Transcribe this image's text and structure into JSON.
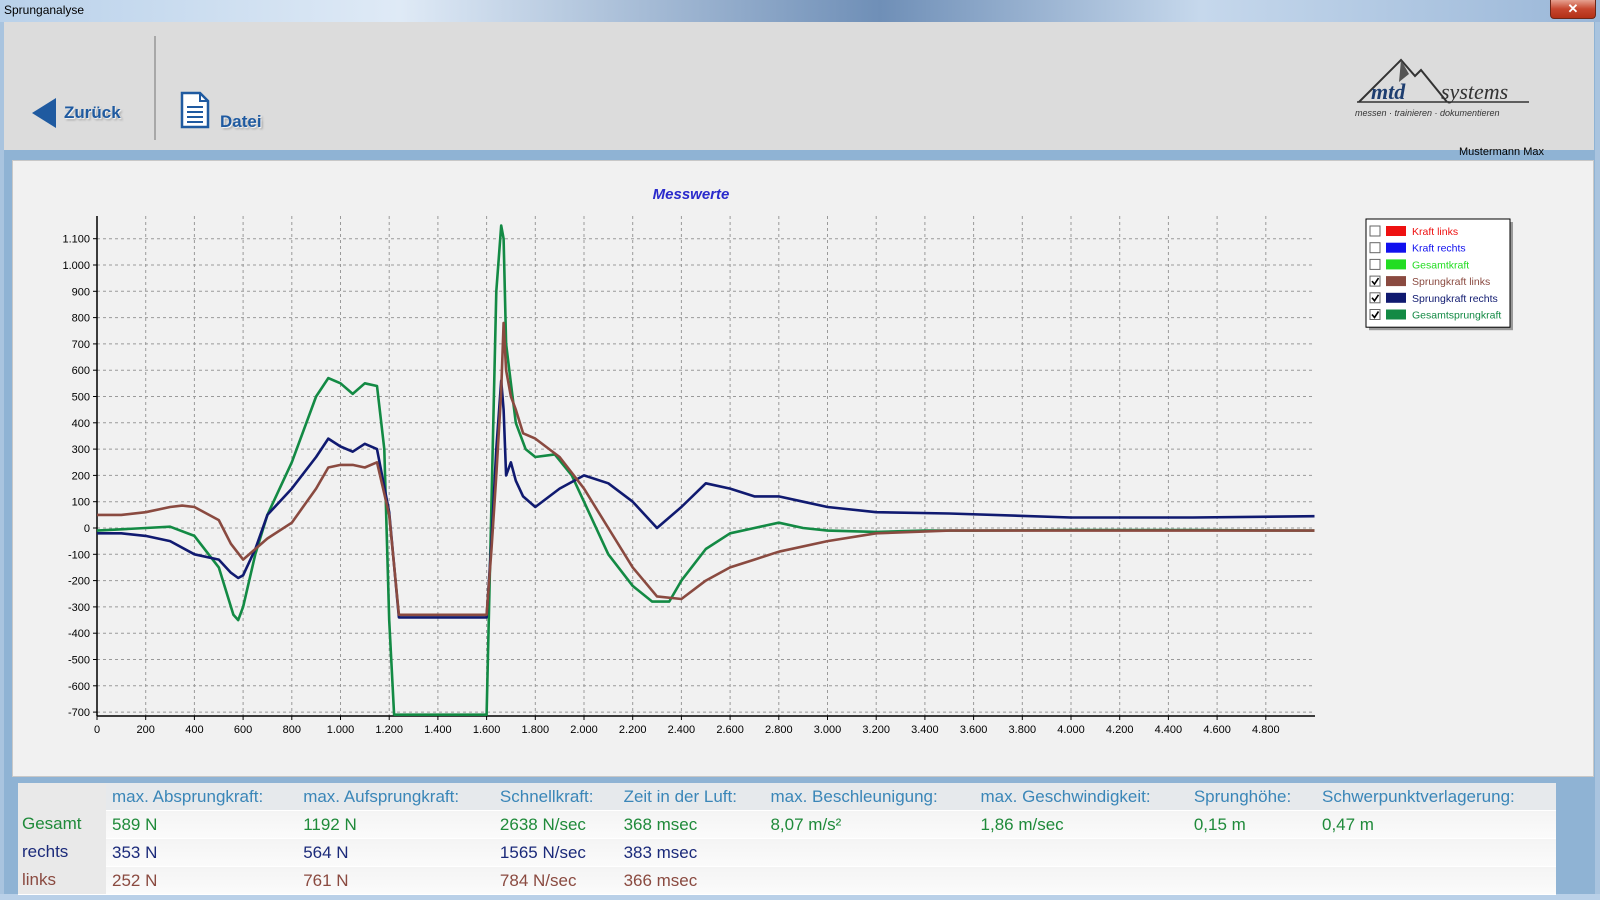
{
  "window": {
    "title": "Sprunganalyse",
    "close_glyph": "✕"
  },
  "toolbar": {
    "back_label": "Zurück",
    "file_label": "Datei"
  },
  "logo": {
    "brand1": "mtd",
    "brand2": "systems",
    "tagline": "messen · trainieren · dokumentieren"
  },
  "user": {
    "name": "Mustermann Max"
  },
  "chart_data": {
    "type": "line",
    "title": "Messwerte",
    "xlim": [
      0,
      5000
    ],
    "ylim": [
      -730,
      1200
    ],
    "x_ticks": [
      0,
      200,
      400,
      600,
      800,
      1000,
      1200,
      1400,
      1600,
      1800,
      2000,
      2200,
      2400,
      2600,
      2800,
      3000,
      3200,
      3400,
      3600,
      3800,
      4000,
      4200,
      4400,
      4600,
      4800
    ],
    "x_tick_labels": [
      "0",
      "200",
      "400",
      "600",
      "800",
      "1.000",
      "1.200",
      "1.400",
      "1.600",
      "1.800",
      "2.000",
      "2.200",
      "2.400",
      "2.600",
      "2.800",
      "3.000",
      "3.200",
      "3.400",
      "3.600",
      "3.800",
      "4.000",
      "4.200",
      "4.400",
      "4.600",
      "4.800"
    ],
    "y_ticks": [
      1100,
      1000,
      900,
      800,
      700,
      600,
      500,
      400,
      300,
      200,
      100,
      0,
      -100,
      -200,
      -300,
      -400,
      -500,
      -600,
      -700
    ],
    "y_tick_labels": [
      "1.100",
      "1.000",
      "900",
      "800",
      "700",
      "600",
      "500",
      "400",
      "300",
      "200",
      "100",
      "0",
      "-100",
      "-200",
      "-300",
      "-400",
      "-500",
      "-600",
      "-700"
    ],
    "grid": true,
    "legend_position": "top-right",
    "legend": [
      {
        "name": "Kraft links",
        "color": "#ee1111",
        "checked": false
      },
      {
        "name": "Kraft rechts",
        "color": "#1111ee",
        "checked": false
      },
      {
        "name": "Gesamtkraft",
        "color": "#22dd22",
        "checked": false
      },
      {
        "name": "Sprungkraft links",
        "color": "#8a4a40",
        "checked": true
      },
      {
        "name": "Sprungkraft rechts",
        "color": "#101a70",
        "checked": true
      },
      {
        "name": "Gesamtsprungkraft",
        "color": "#138a44",
        "checked": true
      }
    ],
    "series": [
      {
        "name": "Gesamtsprungkraft",
        "color": "#138a44",
        "x": [
          0,
          100,
          200,
          300,
          400,
          500,
          560,
          580,
          600,
          650,
          700,
          800,
          900,
          950,
          1000,
          1050,
          1100,
          1150,
          1180,
          1200,
          1220,
          1600,
          1620,
          1640,
          1660,
          1670,
          1680,
          1700,
          1720,
          1760,
          1800,
          1880,
          1950,
          2000,
          2100,
          2200,
          2280,
          2350,
          2400,
          2500,
          2600,
          2700,
          2800,
          2900,
          3000,
          3200,
          3400,
          3600,
          4000,
          4500,
          5000
        ],
        "y": [
          -10,
          -5,
          0,
          5,
          -30,
          -150,
          -330,
          -350,
          -300,
          -100,
          50,
          250,
          500,
          570,
          550,
          510,
          550,
          540,
          300,
          -350,
          -710,
          -710,
          100,
          900,
          1150,
          1100,
          700,
          550,
          400,
          300,
          270,
          280,
          200,
          100,
          -100,
          -220,
          -280,
          -280,
          -200,
          -80,
          -20,
          0,
          20,
          0,
          -10,
          -15,
          -10,
          -10,
          -8,
          -8,
          -10
        ]
      },
      {
        "name": "Sprungkraft rechts",
        "color": "#101a70",
        "x": [
          0,
          100,
          200,
          300,
          400,
          500,
          550,
          580,
          600,
          650,
          700,
          800,
          900,
          950,
          1000,
          1050,
          1100,
          1150,
          1200,
          1240,
          1600,
          1620,
          1640,
          1660,
          1670,
          1680,
          1700,
          1720,
          1750,
          1800,
          1900,
          2000,
          2100,
          2200,
          2300,
          2400,
          2500,
          2600,
          2700,
          2800,
          2900,
          3000,
          3200,
          3500,
          4000,
          4500,
          5000
        ],
        "y": [
          -20,
          -20,
          -30,
          -50,
          -100,
          -120,
          -170,
          -190,
          -180,
          -80,
          50,
          150,
          270,
          340,
          310,
          290,
          320,
          300,
          60,
          -340,
          -340,
          -50,
          300,
          560,
          450,
          200,
          250,
          180,
          120,
          80,
          150,
          200,
          170,
          100,
          0,
          80,
          170,
          150,
          120,
          120,
          100,
          80,
          60,
          55,
          40,
          40,
          45
        ]
      },
      {
        "name": "Sprungkraft links",
        "color": "#8a4a40",
        "x": [
          0,
          100,
          200,
          300,
          350,
          400,
          500,
          550,
          600,
          650,
          700,
          800,
          900,
          950,
          1000,
          1050,
          1100,
          1150,
          1200,
          1240,
          1600,
          1620,
          1640,
          1660,
          1670,
          1680,
          1700,
          1720,
          1750,
          1800,
          1900,
          2000,
          2100,
          2200,
          2300,
          2400,
          2500,
          2600,
          2700,
          2800,
          3000,
          3200,
          3500,
          4000,
          4500,
          5000
        ],
        "y": [
          50,
          50,
          60,
          80,
          85,
          80,
          30,
          -60,
          -120,
          -80,
          -40,
          20,
          150,
          230,
          240,
          240,
          230,
          250,
          50,
          -330,
          -330,
          -80,
          200,
          520,
          780,
          600,
          500,
          450,
          360,
          340,
          270,
          150,
          0,
          -150,
          -260,
          -270,
          -200,
          -150,
          -120,
          -90,
          -50,
          -20,
          -10,
          -10,
          -10,
          -10
        ]
      }
    ]
  },
  "results": {
    "headers": [
      "max. Absprungkraft:",
      "max. Aufsprungkraft:",
      "Schnellkraft:",
      "Zeit in der Luft:",
      "max. Beschleunigung:",
      "max. Geschwindigkeit:",
      "Sprunghöhe:",
      "Schwerpunktverlagerung:"
    ],
    "rows": [
      {
        "label": "Gesamt",
        "values": [
          "589 N",
          "1192 N",
          "2638 N/sec",
          "368 msec",
          "8,07 m/s²",
          "1,86 m/sec",
          "0,15 m",
          "0,47 m"
        ]
      },
      {
        "label": "rechts",
        "values": [
          "353 N",
          "564 N",
          "1565 N/sec",
          "383 msec",
          "",
          "",
          "",
          ""
        ]
      },
      {
        "label": "links",
        "values": [
          "252 N",
          "761 N",
          "784 N/sec",
          "366 msec",
          "",
          "",
          "",
          ""
        ]
      }
    ]
  }
}
